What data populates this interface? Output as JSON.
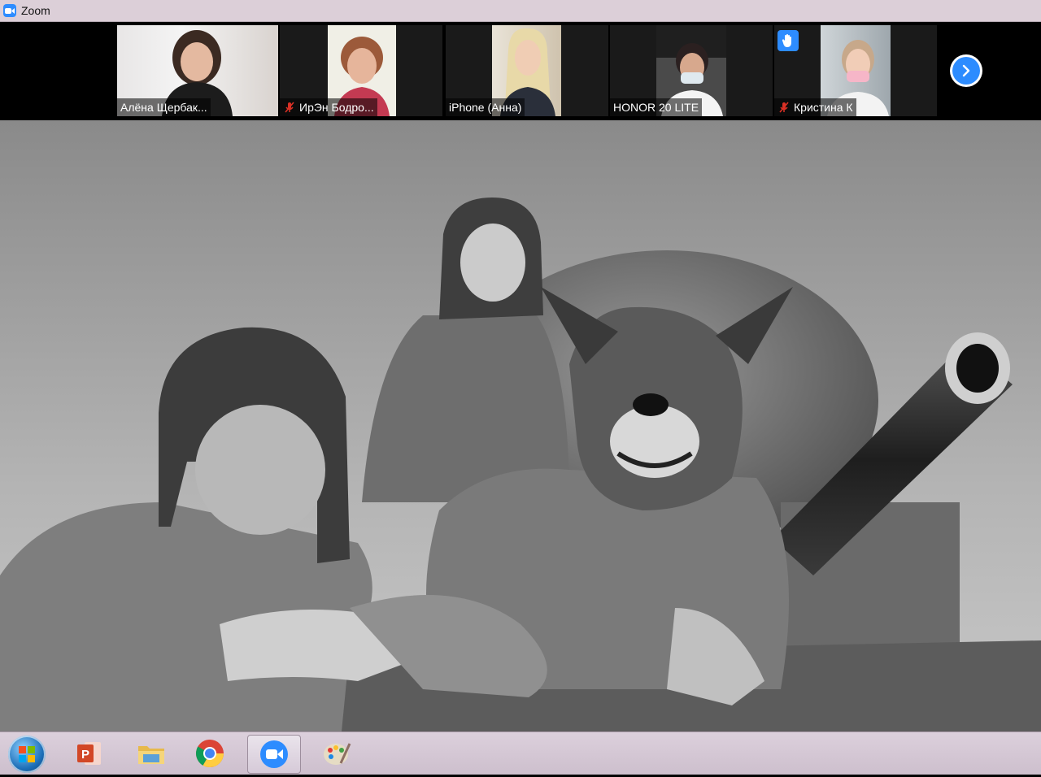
{
  "window": {
    "title": "Zoom"
  },
  "participants": [
    {
      "name": "Алёна Щербак...",
      "muted": false,
      "hand_raised": false
    },
    {
      "name": "ИрЭн Бодро...",
      "muted": true,
      "hand_raised": false
    },
    {
      "name": "iPhone (Анна)",
      "muted": false,
      "hand_raised": false
    },
    {
      "name": "HONOR 20 LITE",
      "muted": false,
      "hand_raised": false
    },
    {
      "name": "Кристина К",
      "muted": true,
      "hand_raised": true
    }
  ],
  "strip": {
    "next_icon": "chevron-right-icon"
  },
  "taskbar": {
    "items": [
      "start-orb",
      "powerpoint-icon",
      "file-explorer-icon",
      "chrome-icon",
      "zoom-icon",
      "paint-icon"
    ],
    "active": "zoom-icon"
  },
  "colors": {
    "accent": "#2d8cff",
    "mute": "#d93025"
  }
}
